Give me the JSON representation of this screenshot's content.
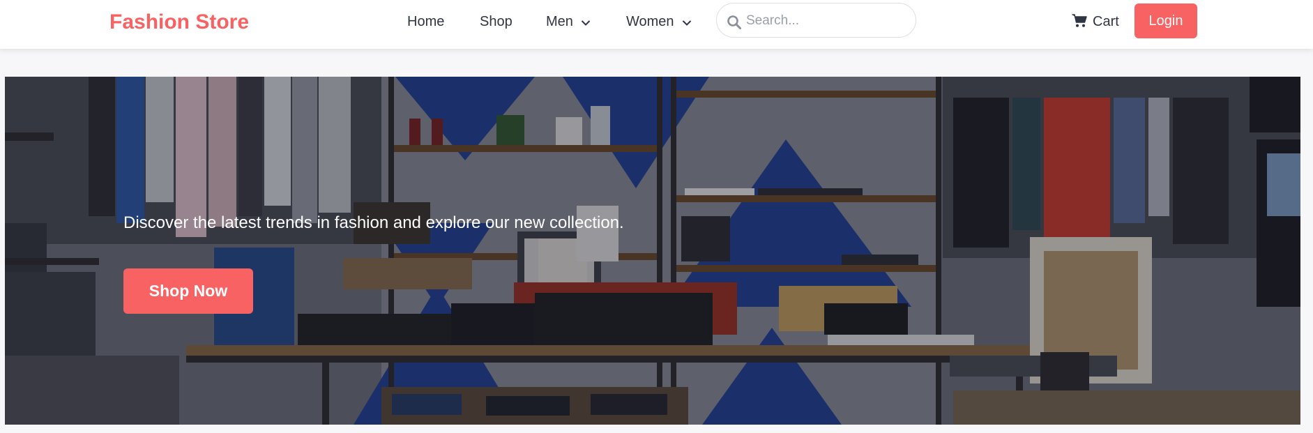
{
  "navbar": {
    "brand": "Fashion Store",
    "links": [
      {
        "label": "Home"
      },
      {
        "label": "Shop"
      },
      {
        "label": "Men",
        "has_dropdown": true
      },
      {
        "label": "Women",
        "has_dropdown": true
      }
    ],
    "search": {
      "placeholder": "Search...",
      "value": "",
      "icon": "search-icon"
    },
    "cart": {
      "label": "Cart",
      "icon": "cart-icon"
    },
    "login_label": "Login"
  },
  "hero": {
    "tagline": "Discover the latest trends in fashion and explore our new collection.",
    "cta_label": "Shop Now"
  },
  "colors": {
    "accent": "#f96262",
    "nav_text": "#2f3542",
    "page_background": "#f7f7fa"
  }
}
